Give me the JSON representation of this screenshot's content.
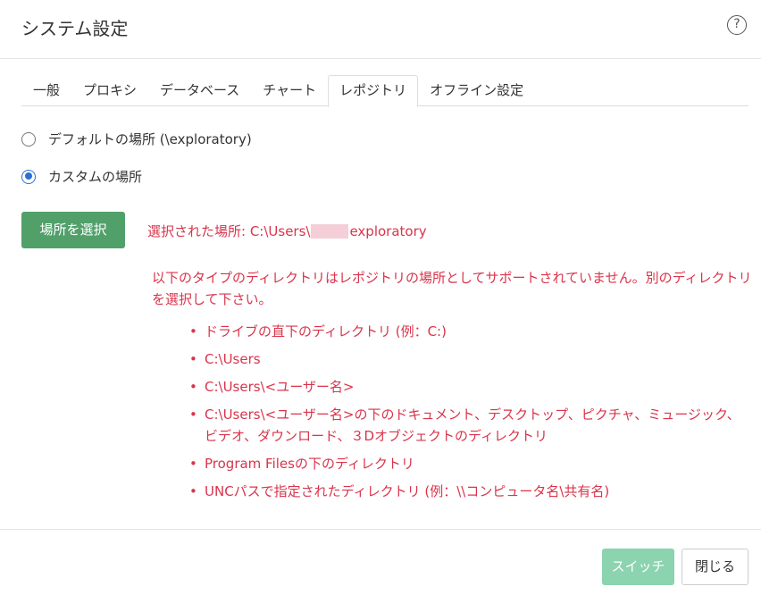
{
  "dialog": {
    "title": "システム設定",
    "help_icon": "?"
  },
  "tabs": [
    {
      "label": "一般",
      "active": false
    },
    {
      "label": "プロキシ",
      "active": false
    },
    {
      "label": "データベース",
      "active": false
    },
    {
      "label": "チャート",
      "active": false
    },
    {
      "label": "レポジトリ",
      "active": true
    },
    {
      "label": "オフライン設定",
      "active": false
    }
  ],
  "repository": {
    "default_option": "デフォルトの場所 (\\exploratory)",
    "custom_option": "カスタムの場所",
    "selected_option": "custom",
    "select_button": "場所を選択",
    "selected_path_prefix": "選択された場所: C:\\Users\\",
    "selected_path_suffix": "exploratory",
    "warning": "以下のタイプのディレクトリはレポジトリの場所としてサポートされていません。別のディレクトリを選択して下さい。",
    "unsupported": [
      "ドライブの直下のディレクトリ (例：C:)",
      "C:\\Users",
      "C:\\Users\\<ユーザー名>",
      "C:\\Users\\<ユーザー名>の下のドキュメント、デスクトップ、ピクチャ、ミュージック、ビデオ、ダウンロード、３Dオブジェクトのディレクトリ",
      "Program Filesの下のディレクトリ",
      "UNCパスで指定されたディレクトリ (例：\\\\コンピュータ名\\共有名)"
    ]
  },
  "footer": {
    "switch_button": "スイッチ",
    "close_button": "閉じる"
  },
  "colors": {
    "primary_green": "#51a06a",
    "disabled_green": "#8cd3b0",
    "error_red": "#d9344b",
    "radio_blue": "#2f6fd1"
  },
  "icons": {
    "help": "help-icon",
    "radio_unchecked": "radio-unchecked",
    "radio_checked": "radio-checked"
  }
}
